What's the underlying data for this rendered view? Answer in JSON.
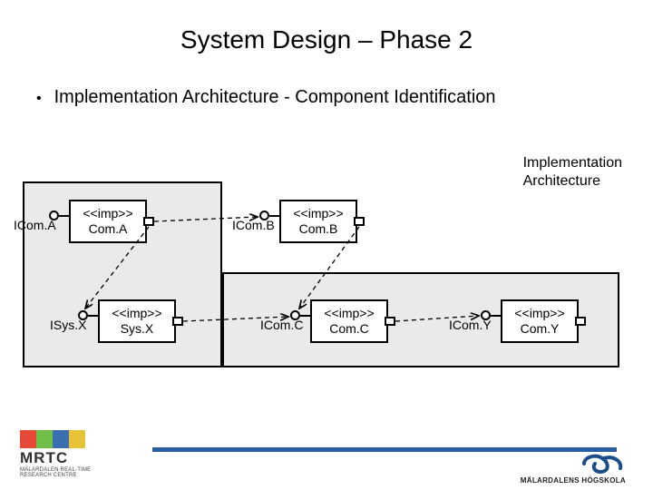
{
  "title": "System Design – Phase 2",
  "bullet": "Implementation Architecture - Component Identification",
  "arch_label_line1": "Implementation",
  "arch_label_line2": "Architecture",
  "components": {
    "comA": {
      "stereo": "<<imp>>",
      "name": "Com.A",
      "interface": "ICom.A"
    },
    "comB": {
      "stereo": "<<imp>>",
      "name": "Com.B",
      "interface": "ICom.B"
    },
    "sysX": {
      "stereo": "<<imp>>",
      "name": "Sys.X",
      "interface": "ISys.X"
    },
    "comC": {
      "stereo": "<<imp>>",
      "name": "Com.C",
      "interface": "ICom.C"
    },
    "comY": {
      "stereo": "<<imp>>",
      "name": "Com.Y",
      "interface": "ICom.Y"
    }
  },
  "footer": {
    "mrtc_title": "MRTC",
    "mrtc_sub1": "MÄLARDALEN REAL-TIME",
    "mrtc_sub2": "RESEARCH CENTRE",
    "mdh": "MÄLARDALENS HÖGSKOLA"
  }
}
